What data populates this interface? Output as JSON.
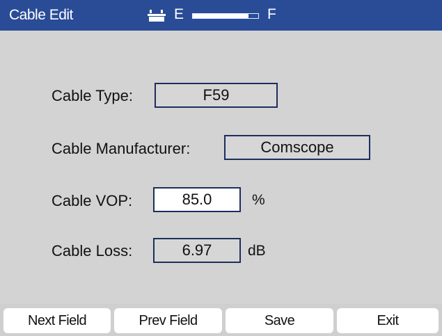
{
  "header": {
    "title": "Cable Edit",
    "gauge_empty_label": "E",
    "gauge_full_label": "F",
    "gauge_level": 0.85
  },
  "form": {
    "cable_type": {
      "label": "Cable Type:",
      "value": "F59"
    },
    "cable_manufacturer": {
      "label": "Cable Manufacturer:",
      "value": "Comscope"
    },
    "cable_vop": {
      "label": "Cable VOP:",
      "value": "85.0",
      "unit": "%"
    },
    "cable_loss": {
      "label": "Cable Loss:",
      "value": "6.97",
      "unit": "dB"
    }
  },
  "softkeys": {
    "next_field": "Next Field",
    "prev_field": "Prev Field",
    "save": "Save",
    "exit": "Exit"
  },
  "colors": {
    "titlebar": "#2a4c97",
    "panel": "#d3d3d3",
    "field_border": "#1d2d5e"
  }
}
